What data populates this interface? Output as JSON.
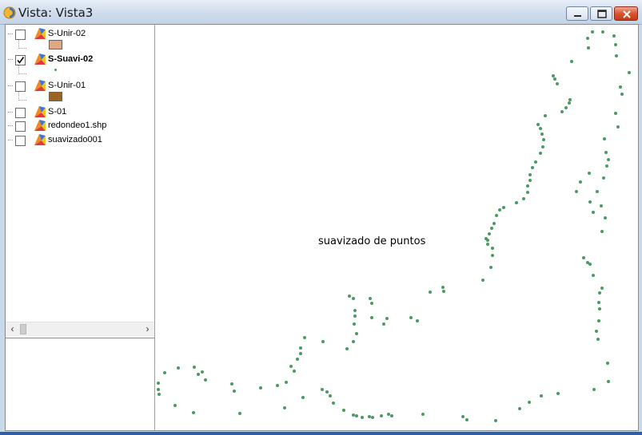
{
  "window": {
    "title": "Vista: Vista3",
    "title_bar_color": "#cfdcec",
    "accent_close": "#d9542e"
  },
  "toc": {
    "layers": [
      {
        "name": "S-Unir-02",
        "checked": false,
        "bold": false,
        "legend": {
          "type": "fill",
          "color": "#e0a882"
        }
      },
      {
        "name": "S-Suavi-02",
        "checked": true,
        "bold": true,
        "legend": {
          "type": "point",
          "color": "#4a9a62"
        }
      },
      {
        "name": "S-Unir-01",
        "checked": false,
        "bold": false,
        "legend": {
          "type": "fill",
          "color": "#9b6424"
        }
      },
      {
        "name": "S-01",
        "checked": false,
        "bold": false,
        "legend": null
      },
      {
        "name": "redondeo1.shp",
        "checked": false,
        "bold": false,
        "legend": null
      },
      {
        "name": "suavizado001",
        "checked": false,
        "bold": false,
        "legend": null
      }
    ],
    "scroll_left_icon": "chevron-left-icon",
    "scroll_right_icon": "chevron-right-icon"
  },
  "map": {
    "label": "suavizado de puntos",
    "point_color": "#4a9a62",
    "background": "#ffffff"
  }
}
